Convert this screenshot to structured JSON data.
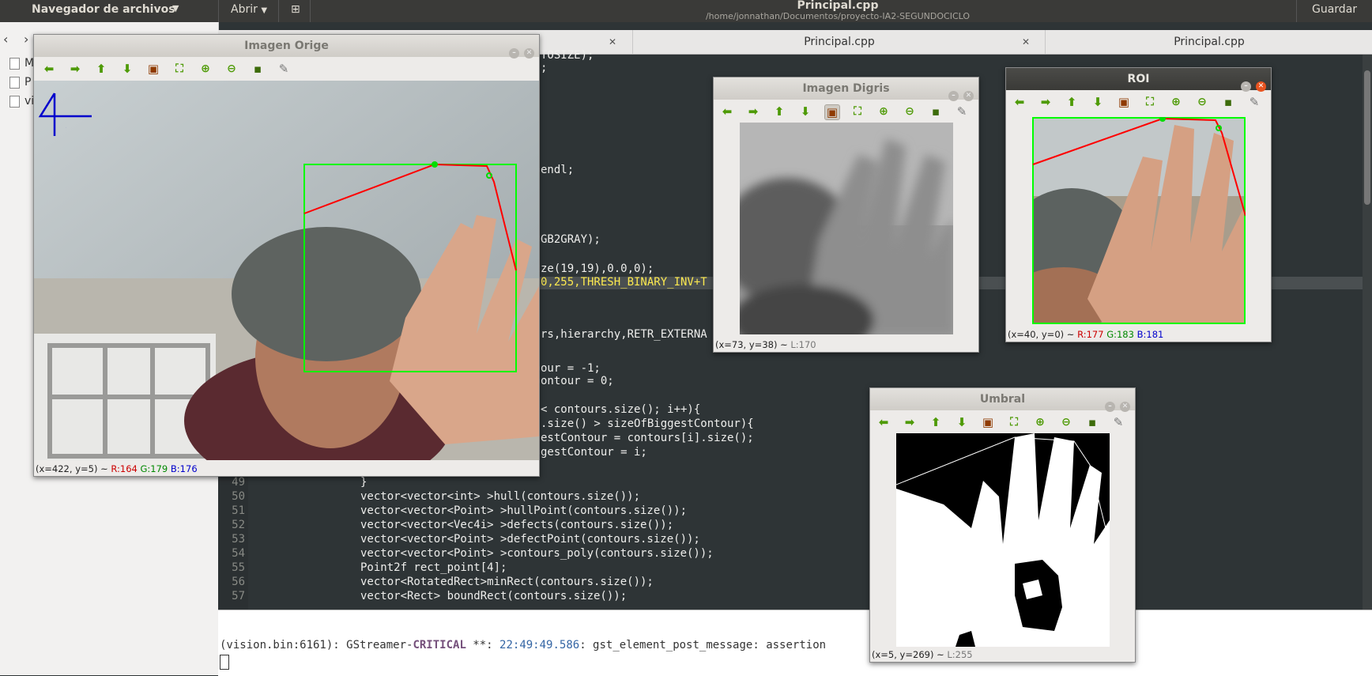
{
  "topbar": {
    "app_menu": "Navegador de archivos",
    "open_button": "Abrir",
    "title": "Principal.cpp",
    "path": "/home/jonnathan/Documentos/proyecto-IA2-SEGUNDOCICLO",
    "save_button": "Guardar",
    "new_tab_icon": "new-tab-icon"
  },
  "sidebar": {
    "items": [
      {
        "label": "M"
      },
      {
        "label": "P"
      },
      {
        "label": "vi"
      }
    ]
  },
  "editor": {
    "tabs": [
      {
        "label": "Principal.cpp"
      },
      {
        "label": "Principal.cpp"
      }
    ],
    "visible_fragments": [
      {
        "text": "TOSIZE);"
      },
      {
        "text": ";"
      },
      {
        "text": "endl;"
      },
      {
        "text": "GB2GRAY);"
      },
      {
        "text": "ze(19,19),0.0,0);"
      },
      {
        "text": "0,255,THRESH_BINARY_INV+T"
      },
      {
        "text": "rs,hierarchy,RETR_EXTERNA"
      },
      {
        "text": "our = -1;"
      },
      {
        "text": "ontour = 0;"
      },
      {
        "text": "< contours.size(); i++){"
      },
      {
        "text": ".size() > sizeOfBiggestContour){"
      },
      {
        "text": "estContour = contours[i].size();"
      },
      {
        "text": "gestContour = i;"
      }
    ],
    "lines": [
      {
        "num": "49",
        "text": "}"
      },
      {
        "num": "50",
        "text": "vector<vector<int> >hull(contours.size());"
      },
      {
        "num": "51",
        "text": "vector<vector<Point> >hullPoint(contours.size());"
      },
      {
        "num": "52",
        "text": "vector<vector<Vec4i> >defects(contours.size());"
      },
      {
        "num": "53",
        "text": "vector<vector<Point> >defectPoint(contours.size());"
      },
      {
        "num": "54",
        "text": "vector<vector<Point> >contours_poly(contours.size());"
      },
      {
        "num": "55",
        "text": "Point2f rect_point[4];"
      },
      {
        "num": "56",
        "text": "vector<RotatedRect>minRect(contours.size());"
      },
      {
        "num": "57",
        "text": "vector<Rect> boundRect(contours.size());"
      }
    ]
  },
  "terminal": {
    "prefix": "(vision.bin:6161): GStreamer-",
    "level": "CRITICAL",
    "mid": " **: ",
    "time": "22:49:49.586",
    "suffix": ": gst_element_post_message: assertion"
  },
  "windows": {
    "origen": {
      "title": "Imagen Orige",
      "overlay_digit": "4",
      "status_pos": "(x=422, y=5) ~ ",
      "r": "R:164",
      "g": "G:179",
      "b": "B:176"
    },
    "digris": {
      "title": "Imagen Digris",
      "status_pos": "(x=73, y=38) ~ ",
      "l": "L:170"
    },
    "roi": {
      "title": "ROI",
      "status_pos": "(x=40, y=0) ~ ",
      "r": "R:177",
      "g": "G:183",
      "b": "B:181"
    },
    "umbral": {
      "title": "Umbral",
      "status_pos": "(x=5, y=269) ~ ",
      "l": "L:255"
    }
  },
  "toolbar_icons": [
    "arrow-left-icon",
    "arrow-right-icon",
    "arrow-up-icon",
    "arrow-down-icon",
    "image-icon",
    "fit-icon",
    "zoom-in-icon",
    "zoom-out-icon",
    "save-icon",
    "brush-icon"
  ],
  "colors": {
    "hull_line": "#ff0000",
    "bounding_box": "#00ff00",
    "contour_point": "#00dd00",
    "digit": "#0000cc",
    "ubuntu_orange": "#e95420"
  }
}
